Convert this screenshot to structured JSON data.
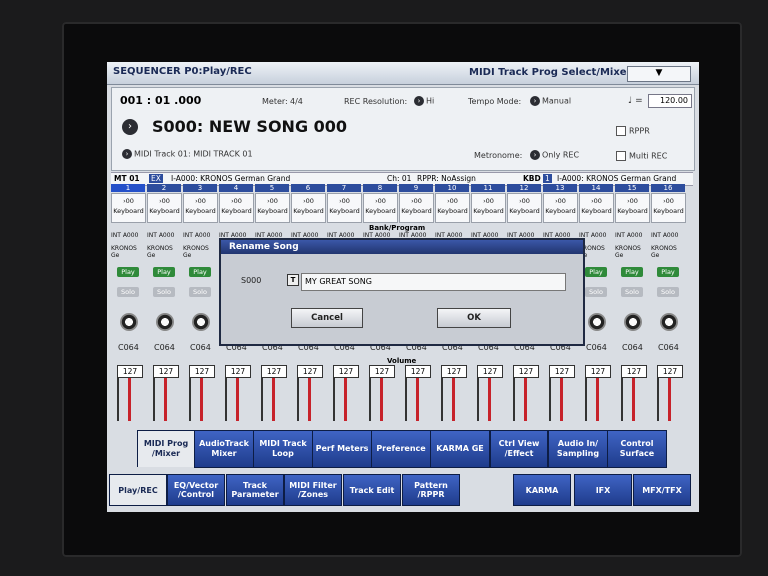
{
  "window": {
    "title": "SEQUENCER P0:Play/REC",
    "page_menu": "MIDI Track Prog Select/Mixer",
    "menu_arrow": "▼"
  },
  "info": {
    "position": "001 : 01 .000",
    "meter_label": "Meter:",
    "meter_value": "4/4",
    "rec_res_label": "REC Resolution:",
    "rec_res_value": "Hi",
    "tempo_mode_label": "Tempo Mode:",
    "tempo_mode_value": "Manual",
    "tempo_symbol": "♩ =",
    "tempo_value": "120.00",
    "song_name": "S000: NEW SONG 000",
    "rppr_label": "RPPR",
    "track_label": "MIDI Track 01: MIDI TRACK 01",
    "metronome_label": "Metronome:",
    "metronome_value": "Only REC",
    "multirec_label": "Multi REC"
  },
  "trackinfo": {
    "mt": "MT 01",
    "ext": "EX",
    "program": "I-A000: KRONOS German Grand",
    "ch": "Ch: 01",
    "rppr": "RPPR: NoAssign",
    "kbd": "KBD",
    "kbd_num": "1",
    "kbd_program": "I-A000: KRONOS German Grand"
  },
  "track_numbers": [
    "1",
    "2",
    "3",
    "4",
    "5",
    "6",
    "7",
    "8",
    "9",
    "10",
    "11",
    "12",
    "13",
    "14",
    "15",
    "16"
  ],
  "prog_label": "Keyboard",
  "prog_value": "00",
  "bank_program_label": "Bank/Program",
  "int_label": "INT A000",
  "kronos_short": "KRONOS Ge",
  "play_label": "Play",
  "solo_label": "Solo",
  "pan_value": "C064",
  "volume_label": "Volume",
  "fader_value": "127",
  "dialog": {
    "title": "Rename Song",
    "song_id": "S000",
    "text_btn": "T",
    "name_value": "MY GREAT SONG",
    "cancel": "Cancel",
    "ok": "OK"
  },
  "tabs_top": [
    "MIDI Prog /Mixer",
    "AudioTrack Mixer",
    "MIDI Track Loop",
    "Perf Meters",
    "Preference",
    "KARMA GE",
    "Ctrl View /Effect",
    "Audio In/ Sampling",
    "Control Surface"
  ],
  "tabs_bottom": [
    "Play/REC",
    "EQ/Vector /Control",
    "Track Parameter",
    "MIDI Filter /Zones",
    "Track Edit",
    "Pattern /RPPR",
    "KARMA",
    "IFX",
    "MFX/TFX"
  ]
}
